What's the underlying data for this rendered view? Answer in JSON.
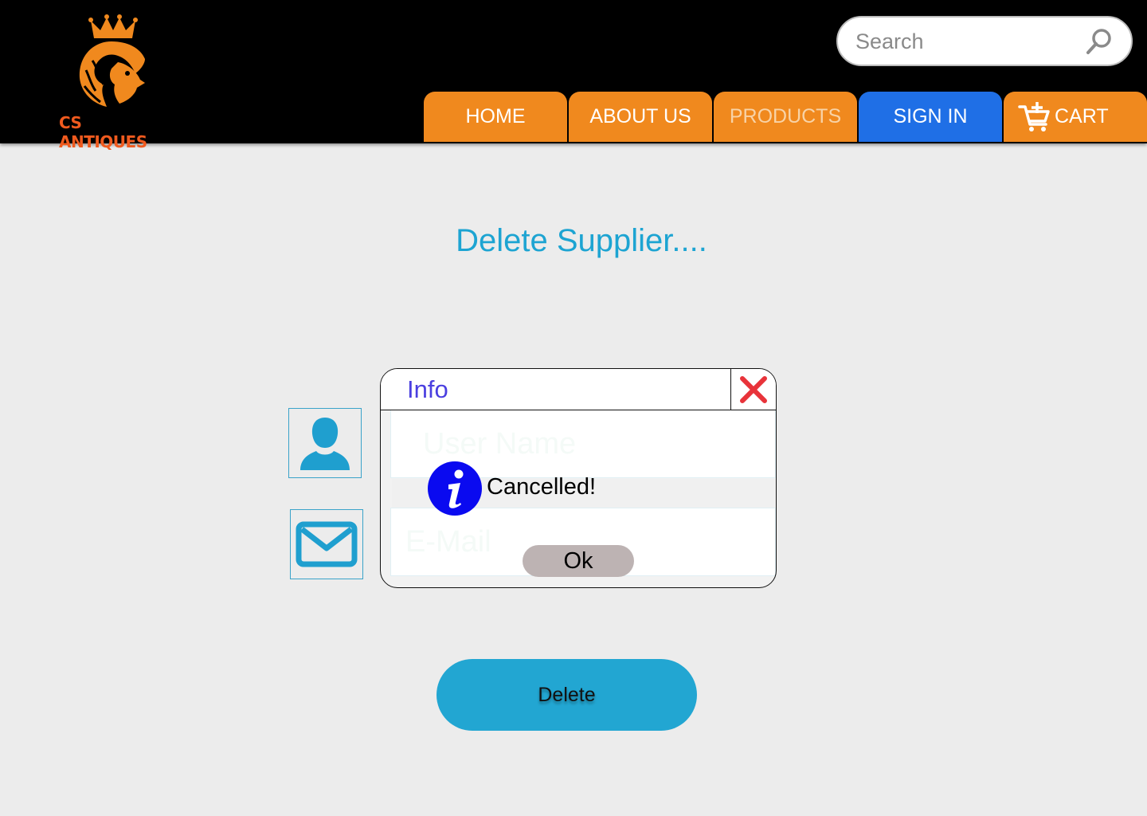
{
  "header": {
    "logo_text": "CS ANTIQUES",
    "search": {
      "placeholder": "Search",
      "value": ""
    },
    "nav": {
      "home": "HOME",
      "about": "ABOUT US",
      "products": "PRODUCTS",
      "signin": "SIGN IN",
      "cart": "CART"
    }
  },
  "main": {
    "title": "Delete Supplier....",
    "username": {
      "placeholder": "User Name",
      "value": ""
    },
    "email": {
      "placeholder": "E-Mail",
      "value": ""
    },
    "delete_label": "Delete"
  },
  "dialog": {
    "title": "Info",
    "message": "Cancelled!",
    "ok_label": "Ok"
  },
  "colors": {
    "nav_orange": "#f0891e",
    "signin_blue": "#1f6fe6",
    "title_cyan": "#1da4d2",
    "delete_button": "#22a6d2",
    "info_blue": "#0a0af0",
    "close_red": "#e8333a",
    "ok_button": "#bdb3b3"
  },
  "icons": {
    "logo": "lion-crown-logo",
    "search": "search-icon",
    "cart": "cart-plus-icon",
    "user": "user-icon",
    "mail": "mail-icon",
    "info": "info-icon",
    "close": "close-icon"
  }
}
